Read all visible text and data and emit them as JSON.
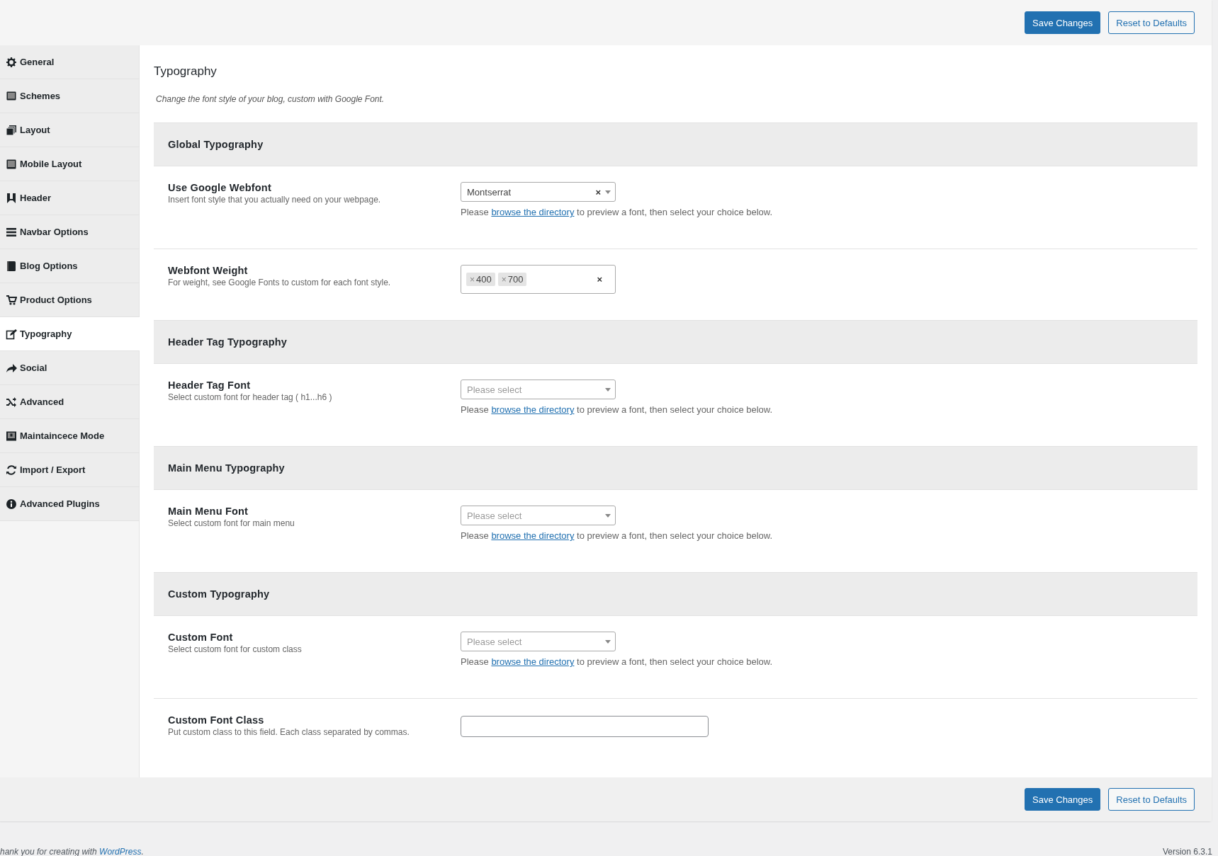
{
  "toolbar_top": {
    "buttons": [
      {
        "label": "Save Changes",
        "kind": "primary"
      },
      {
        "label": "Reset to Defaults",
        "kind": "secondary"
      }
    ]
  },
  "sidebar": {
    "items": [
      {
        "label": "General",
        "selected": false
      },
      {
        "label": "Schemes",
        "selected": false
      },
      {
        "label": "Layout",
        "selected": false
      },
      {
        "label": "Mobile Layout",
        "selected": false
      },
      {
        "label": "Header",
        "selected": false
      },
      {
        "label": "Navbar Options",
        "selected": false
      },
      {
        "label": "Blog Options",
        "selected": false
      },
      {
        "label": "Product Options",
        "selected": false
      },
      {
        "label": "Typography",
        "selected": true
      },
      {
        "label": "Social",
        "selected": false
      },
      {
        "label": "Advanced",
        "selected": false
      },
      {
        "label": "Maintaincece Mode",
        "selected": false
      },
      {
        "label": "Import / Export",
        "selected": false
      },
      {
        "label": "Advanced Plugins",
        "selected": false
      }
    ]
  },
  "page": {
    "title": "Typography",
    "description": "Change the font style of your blog, custom with Google Font.",
    "sections": [
      {
        "title": "Global Typography",
        "fields": [
          {
            "kind": "select",
            "label": "Use Google Webfont",
            "description": "Insert font style that you actually need on your webpage.",
            "value": "Montserrat",
            "clear": "×",
            "help_before": "Please",
            "help_link": "browse the directory",
            "help_after": "to preview a font, then select your choice below."
          },
          {
            "kind": "tags",
            "label": "Webfont Weight",
            "description": "For weight, see Google Fonts to custom for each font style.",
            "tags": [
              {
                "remove": "×",
                "label": "400"
              },
              {
                "remove": "×",
                "label": "700"
              }
            ],
            "clear": "×"
          }
        ]
      },
      {
        "title": "Header Tag Typography",
        "fields": [
          {
            "kind": "select",
            "label": "Header Tag Font",
            "description": "Select custom font for header tag ( h1...h6 )",
            "placeholder": "Please select",
            "help_before": "Please",
            "help_link": "browse the directory",
            "help_after": "to preview a font, then select your choice below."
          }
        ]
      },
      {
        "title": "Main Menu Typography",
        "fields": [
          {
            "kind": "select",
            "label": "Main Menu Font",
            "description": "Select custom font for main menu",
            "placeholder": "Please select",
            "help_before": "Please",
            "help_link": "browse the directory",
            "help_after": "to preview a font, then select your choice below."
          }
        ]
      },
      {
        "title": "Custom Typography",
        "fields": [
          {
            "kind": "select",
            "label": "Custom Font",
            "description": "Select custom font for custom class",
            "placeholder": "Please select",
            "help_before": "Please",
            "help_link": "browse the directory",
            "help_after": "to preview a font, then select your choice below."
          },
          {
            "kind": "text",
            "label": "Custom Font Class",
            "description": "Put custom class to this field. Each class separated by commas."
          }
        ]
      }
    ]
  },
  "toolbar_bottom": {
    "buttons": [
      {
        "label": "Save Changes",
        "kind": "primary"
      },
      {
        "label": "Reset to Defaults",
        "kind": "secondary"
      }
    ]
  },
  "footer": {
    "text_before": "hank you for creating with",
    "link": "WordPress",
    "text_after": ".",
    "version": "Version 6.3.1"
  }
}
